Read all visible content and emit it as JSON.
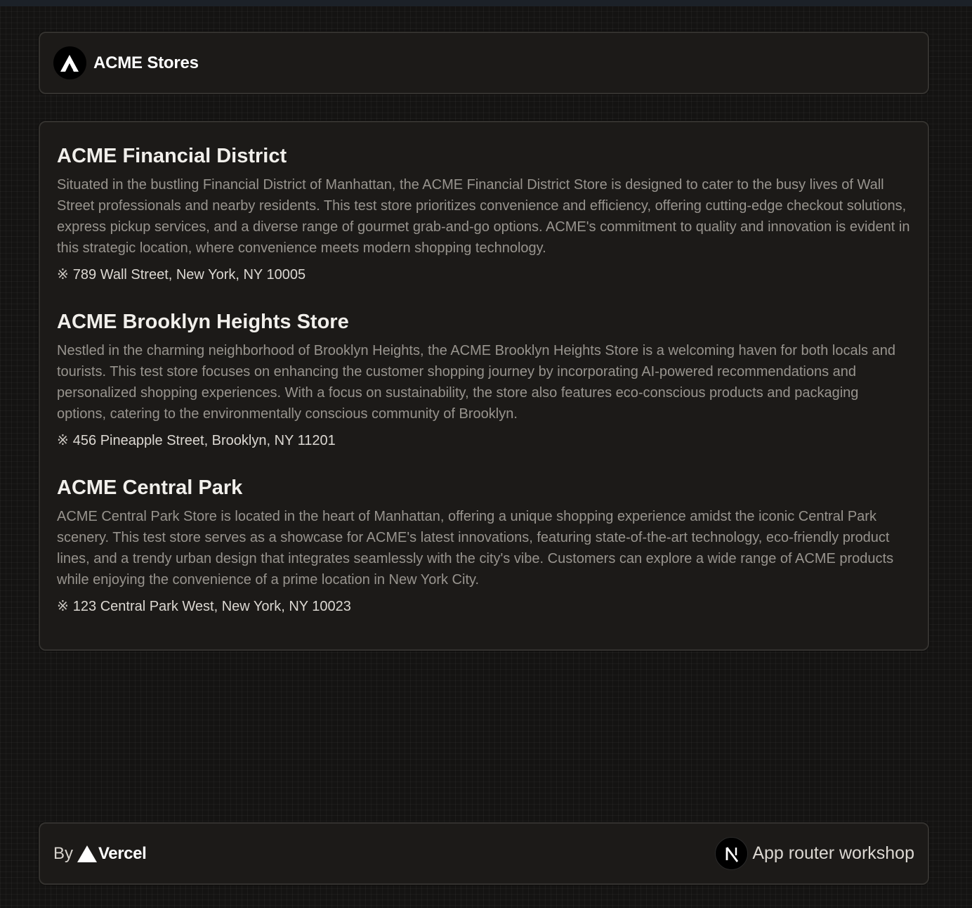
{
  "header": {
    "brand": "ACME Stores",
    "logo_icon": "acme-logo-icon"
  },
  "stores": [
    {
      "name": "ACME Financial District",
      "description": "Situated in the bustling Financial District of Manhattan, the ACME Financial District Store is designed to cater to the busy lives of Wall Street professionals and nearby residents. This test store prioritizes convenience and efficiency, offering cutting-edge checkout solutions, express pickup services, and a diverse range of gourmet grab-and-go options. ACME's commitment to quality and innovation is evident in this strategic location, where convenience meets modern shopping technology.",
      "address_icon": "※",
      "address": "789 Wall Street, New York, NY 10005"
    },
    {
      "name": "ACME Brooklyn Heights Store",
      "description": "Nestled in the charming neighborhood of Brooklyn Heights, the ACME Brooklyn Heights Store is a welcoming haven for both locals and tourists. This test store focuses on enhancing the customer shopping journey by incorporating AI-powered recommendations and personalized shopping experiences. With a focus on sustainability, the store also features eco-conscious products and packaging options, catering to the environmentally conscious community of Brooklyn.",
      "address_icon": "※",
      "address": "456 Pineapple Street, Brooklyn, NY 11201"
    },
    {
      "name": "ACME Central Park",
      "description": "ACME Central Park Store is located in the heart of Manhattan, offering a unique shopping experience amidst the iconic Central Park scenery. This test store serves as a showcase for ACME's latest innovations, featuring state-of-the-art technology, eco-friendly product lines, and a trendy urban design that integrates seamlessly with the city's vibe. Customers can explore a wide range of ACME products while enjoying the convenience of a prime location in New York City.",
      "address_icon": "※",
      "address": "123 Central Park West, New York, NY 10023"
    }
  ],
  "footer": {
    "by_label": "By",
    "vercel_label": "Vercel",
    "workshop_label": "App router workshop"
  },
  "colors": {
    "background": "#141312",
    "panel": "#1c1a18",
    "panel_border": "#34322f",
    "heading": "#f1efeb",
    "body_text": "#98948e"
  }
}
